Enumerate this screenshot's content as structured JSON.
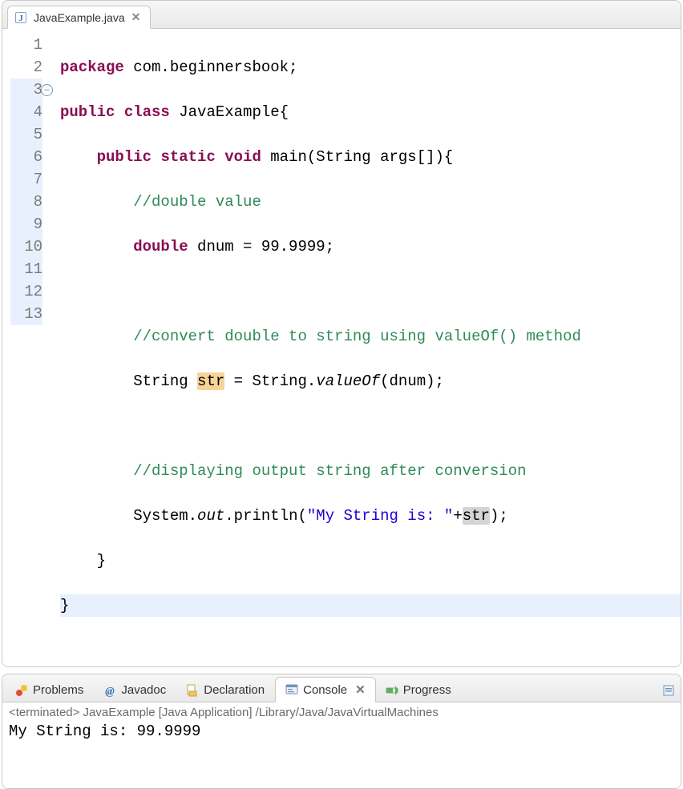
{
  "editor": {
    "tab": {
      "filename": "JavaExample.java"
    },
    "lineNumbers": [
      "1",
      "2",
      "3",
      "4",
      "5",
      "6",
      "7",
      "8",
      "9",
      "10",
      "11",
      "12",
      "13"
    ],
    "code": {
      "l1": {
        "kw1": "package",
        "rest": " com.beginnersbook;"
      },
      "l2": {
        "kw1": "public",
        "kw2": "class",
        "rest": " JavaExample{"
      },
      "l3": {
        "kw1": "public",
        "kw2": "static",
        "kw3": "void",
        "rest1": " main(String args[]){"
      },
      "l4": {
        "cm": "//double value"
      },
      "l5": {
        "kw1": "double",
        "rest": " dnum = 99.9999;"
      },
      "l7": {
        "cm": "//convert double to string using valueOf() method"
      },
      "l8": {
        "a": "String ",
        "mk": "str",
        "b": " = String.",
        "it": "valueOf",
        "c": "(dnum);"
      },
      "l10": {
        "cm": "//displaying output string after conversion"
      },
      "l11": {
        "a": "System.",
        "it": "out",
        "b": ".println(",
        "s": "\"My String is: \"",
        "c": "+",
        "mk": "str",
        "d": ");"
      },
      "l12": {
        "a": "}"
      },
      "l13": {
        "a": "}"
      }
    }
  },
  "bottomTabs": {
    "problems": "Problems",
    "javadoc": "Javadoc",
    "declaration": "Declaration",
    "console": "Console",
    "progress": "Progress"
  },
  "console": {
    "status": "<terminated> JavaExample [Java Application] /Library/Java/JavaVirtualMachines",
    "output": "My String is: 99.9999"
  }
}
